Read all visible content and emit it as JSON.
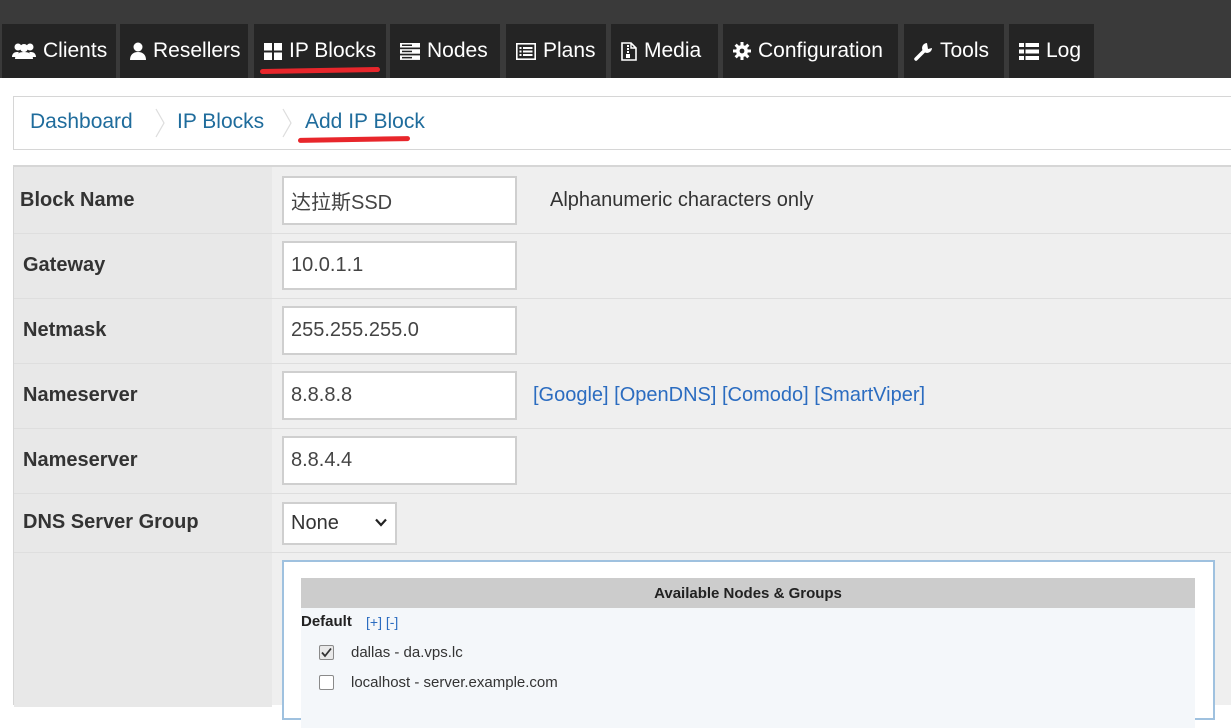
{
  "nav": {
    "tabs": [
      {
        "label": "Clients",
        "icon": "users-icon"
      },
      {
        "label": "Resellers",
        "icon": "user-icon"
      },
      {
        "label": "IP Blocks",
        "icon": "grid-icon",
        "active": true
      },
      {
        "label": "Nodes",
        "icon": "server-icon"
      },
      {
        "label": "Plans",
        "icon": "list-alt-icon"
      },
      {
        "label": "Media",
        "icon": "file-zip-icon"
      },
      {
        "label": "Configuration",
        "icon": "gear-icon"
      },
      {
        "label": "Tools",
        "icon": "wrench-icon"
      },
      {
        "label": "Log",
        "icon": "list-icon"
      }
    ]
  },
  "breadcrumb": {
    "items": [
      "Dashboard",
      "IP Blocks",
      "Add IP Block"
    ]
  },
  "form": {
    "block_name": {
      "label": "Block Name",
      "value": "达拉斯SSD",
      "hint": "Alphanumeric characters only"
    },
    "gateway": {
      "label": "Gateway",
      "value": "10.0.1.1"
    },
    "netmask": {
      "label": "Netmask",
      "value": "255.255.255.0"
    },
    "nameserver1": {
      "label": "Nameserver",
      "value": "8.8.8.8",
      "presets": [
        "[Google]",
        "[OpenDNS]",
        "[Comodo]",
        "[SmartViper]"
      ]
    },
    "nameserver2": {
      "label": "Nameserver",
      "value": "8.8.4.4"
    },
    "dns_group": {
      "label": "DNS Server Group",
      "selected": "None"
    }
  },
  "nodes_panel": {
    "title": "Available Nodes & Groups",
    "group": {
      "name": "Default",
      "expand": "[+]",
      "collapse": "[-]"
    },
    "nodes": [
      {
        "label": "dallas - da.vps.lc",
        "checked": true
      },
      {
        "label": "localhost - server.example.com",
        "checked": false
      }
    ]
  },
  "colors": {
    "nav_bg": "#3a3a3a",
    "tab_bg": "#242424",
    "link": "#1f6c9c",
    "annotation": "#e8262b"
  }
}
